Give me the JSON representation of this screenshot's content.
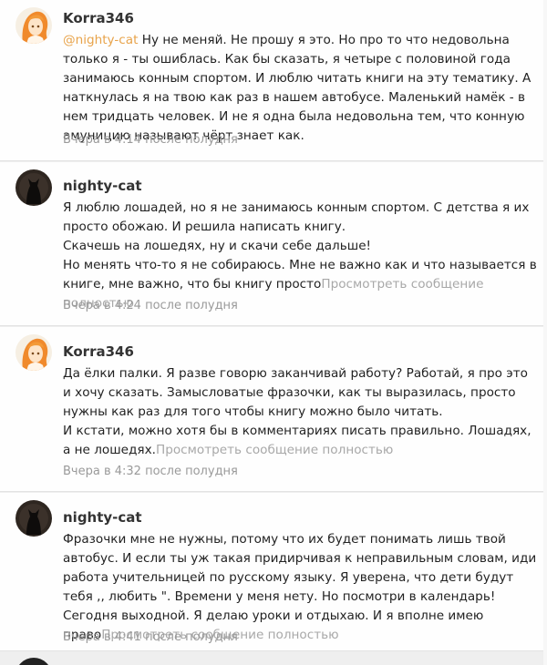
{
  "comments": [
    {
      "author": "Korra346",
      "avatar_icon": "orange-anime-girl-avatar",
      "mention": "@nighty-cat",
      "text": " Ну не меняй. Не прошу я это. Но про то что недовольна только я - ты ошиблась. Как бы сказать, я четыре с половиной года занимаюсь конным спортом. И люблю читать книги на эту тематику. А наткнулась я на твою как раз в нашем автобусе. Маленький намёк - в нем тридцать человек. И не я одна была недовольна тем, что конную амуницию называют чёрт знает как.",
      "time": "Вчера в 4:14 после полудня"
    },
    {
      "author": "nighty-cat",
      "avatar_icon": "black-cat-avatar",
      "lines": [
        "Я люблю лошадей, но я не занимаюсь конным спортом. С детства я их просто обожаю. И решила написать книгу.",
        "Скачешь на лошедях, ну и скачи себе дальше!",
        "Но менять что-то я не собираюсь. Мне не важно как и что называется в книге, мне важно, что бы книгу просто"
      ],
      "more": "Просмотреть сообщение полностью",
      "time": "Вчера в 4:24 после полудня"
    },
    {
      "author": "Korra346",
      "avatar_icon": "orange-anime-girl-avatar",
      "lines": [
        "Да ёлки палки. Я разве говорю заканчивай работу? Работай, я про это и хочу сказать. Замысловатые фразочки, как ты выразилась, просто нужны как раз для того чтобы книгу можно было читать.",
        "И кстати, можно хотя бы в комментариях писать правильно. Лошадях, а не лошедях."
      ],
      "more": "Просмотреть сообщение полностью",
      "time": "Вчера в 4:32 после полудня"
    },
    {
      "author": "nighty-cat",
      "avatar_icon": "black-cat-avatar",
      "lines": [
        "Фразочки мне не нужны, потому что их будет понимать лишь твой автобус. И если ты уж такая придирчивая к неправильным словам, иди работа учительницей по русскому языку. Я уверена, что дети будут тебя ,, любить \". Времени у меня нету. Но посмотри в календарь! Сегодня выходной. Я делаю уроки и отдыхаю. И я вполне имею право"
      ],
      "more": "Просмотреть сообщение полностью",
      "time": "Вчера в 4:41 после полудня"
    }
  ]
}
